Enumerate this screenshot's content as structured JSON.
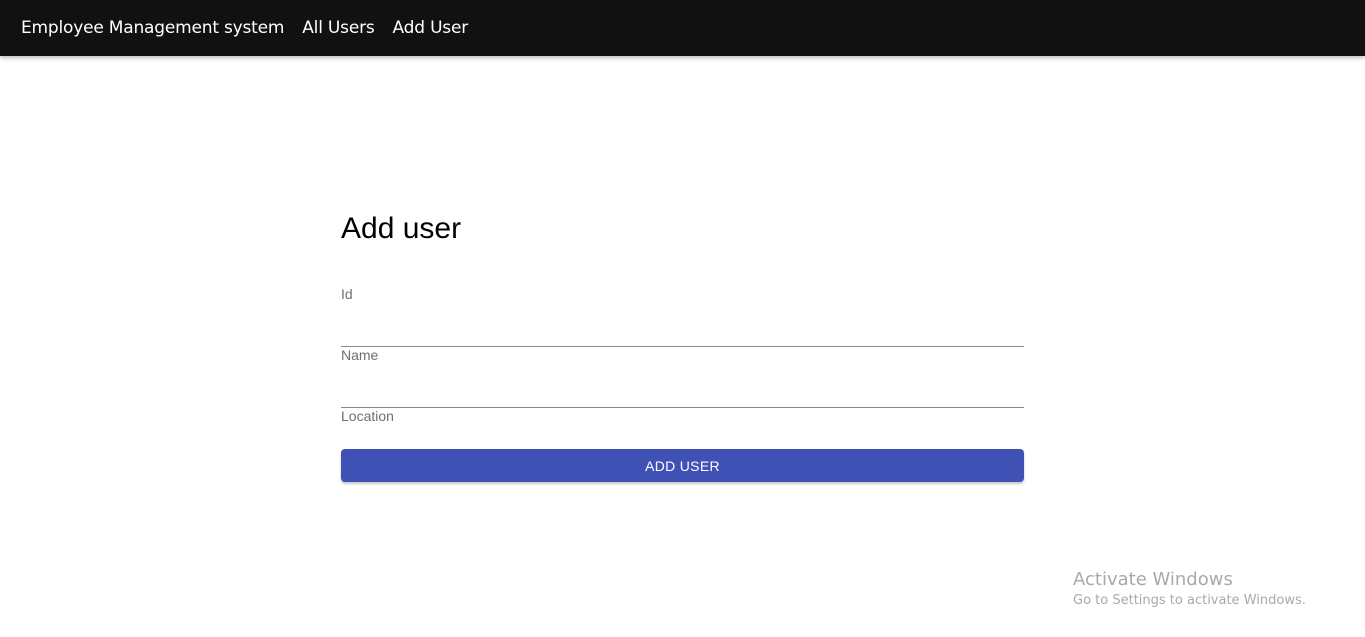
{
  "nav": {
    "brand": "Employee Management system",
    "links": [
      "All Users",
      "Add User"
    ]
  },
  "form": {
    "title": "Add user",
    "fields": [
      {
        "label": "Id",
        "value": ""
      },
      {
        "label": "Name",
        "value": ""
      },
      {
        "label": "Location",
        "value": ""
      }
    ],
    "submit_label": "ADD USER"
  },
  "watermark": {
    "title": "Activate Windows",
    "subtitle": "Go to Settings to activate Windows."
  },
  "colors": {
    "appbar": "#111111",
    "primary": "#3f51b5"
  }
}
